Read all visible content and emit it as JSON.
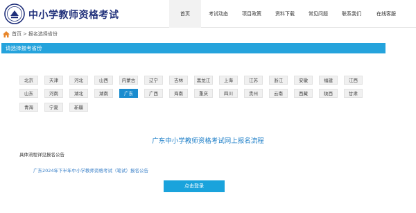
{
  "header": {
    "title": "中小学教师资格考试",
    "logo_icon": "teacher-cert-logo-icon",
    "nav": [
      {
        "label": "首页",
        "active": true
      },
      {
        "label": "考试动态",
        "active": false
      },
      {
        "label": "项目政策",
        "active": false
      },
      {
        "label": "资料下载",
        "active": false
      },
      {
        "label": "常见问题",
        "active": false
      },
      {
        "label": "联系我们",
        "active": false
      },
      {
        "label": "在线客服",
        "active": false
      }
    ]
  },
  "breadcrumb": {
    "home_icon": "home-icon",
    "home": "首页",
    "separator": ">",
    "current": "报名选择省份"
  },
  "section": {
    "title": "请选择报考省份"
  },
  "provinces": {
    "selected": "广东",
    "rows": [
      [
        "北京",
        "天津",
        "河北",
        "山西",
        "内蒙古",
        "辽宁",
        "吉林",
        "黑龙江",
        "上海",
        "江苏",
        "浙江",
        "安徽",
        "福建",
        "江西"
      ],
      [
        "山东",
        "河南",
        "湖北",
        "湖南",
        "广东",
        "广西",
        "海南",
        "重庆",
        "四川",
        "贵州",
        "云南",
        "西藏",
        "陕西",
        "甘肃"
      ],
      [
        "青海",
        "宁夏",
        "新疆"
      ]
    ]
  },
  "process": {
    "title": "广东中小学教师资格考试网上报名流程",
    "detail_note": "具体流程详见报名公告",
    "notice_link": "广东2024年下半年中小学教师资格考试（笔试）报名公告",
    "login_button": "点击登录"
  },
  "colors": {
    "brand_blue": "#25a3dc",
    "active_province": "#1a8ccf",
    "title_navy": "#1f2f7a",
    "process_title": "#1e7fc8",
    "link": "#3a80c8",
    "home_icon_orange": "#e8862a"
  }
}
